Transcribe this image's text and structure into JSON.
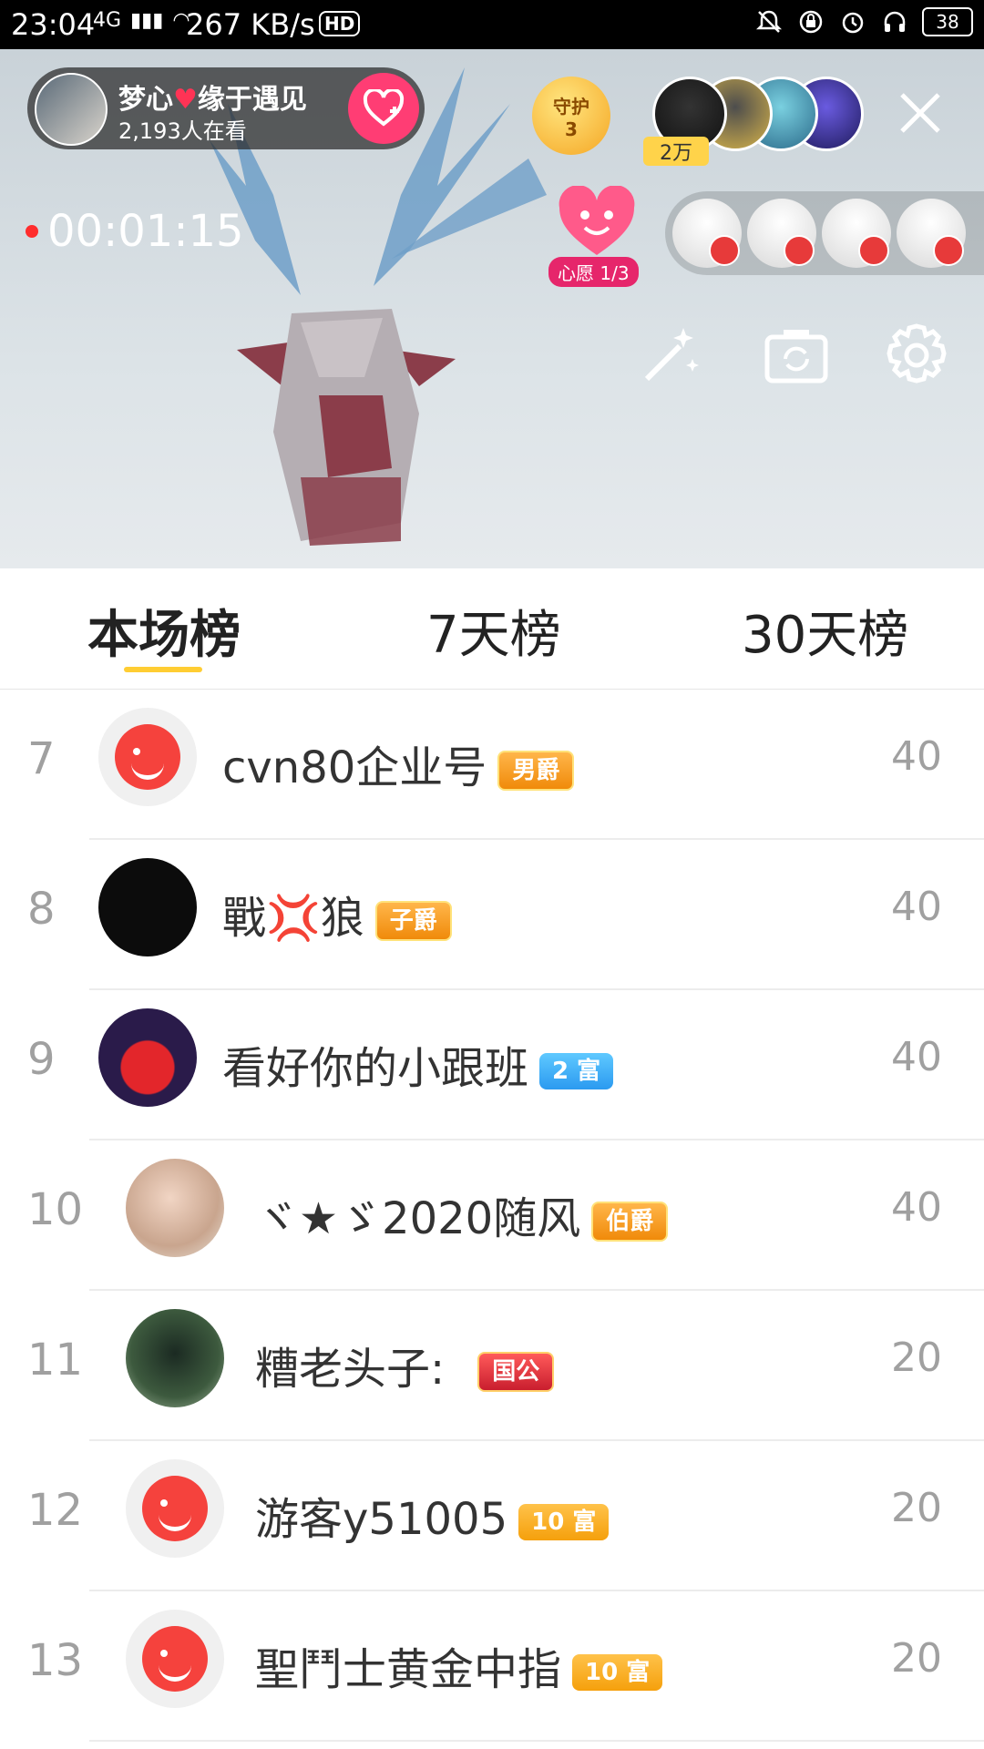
{
  "status_bar": {
    "time": "23:04",
    "network": "4G",
    "speed": "267 KB/s",
    "hd": "HD",
    "battery": "38"
  },
  "live": {
    "host_name": "梦心❤️缘于遇见",
    "host_name_prefix": "梦心",
    "host_name_suffix": "缘于遇见",
    "viewers": "2,193人在看",
    "guard_label": "守护",
    "guard_count": "3",
    "fans_badge": "2万",
    "timer": "00:01:15",
    "wish_label": "心愿 1/3"
  },
  "tabs": [
    {
      "label": "本场榜",
      "active": true
    },
    {
      "label": "7天榜",
      "active": false
    },
    {
      "label": "30天榜",
      "active": false
    }
  ],
  "ranking": [
    {
      "rank": "7",
      "name": "cvn80企业号",
      "badge": "男爵",
      "score": "40"
    },
    {
      "rank": "8",
      "name": "戰💢狼",
      "badge": "子爵",
      "score": "40"
    },
    {
      "rank": "9",
      "name": "看好你的小跟班",
      "badge": "2 富",
      "score": "40"
    },
    {
      "rank": "10",
      "name": "ヾ★ゞ2020随风",
      "badge": "伯爵",
      "score": "40"
    },
    {
      "rank": "11",
      "name": "糟老头子:",
      "badge": "国公",
      "score": "20"
    },
    {
      "rank": "12",
      "name": "游客y51005",
      "badge": "10 富",
      "score": "20"
    },
    {
      "rank": "13",
      "name": "聖鬥士黄金中指",
      "badge": "10 富",
      "score": "20"
    }
  ],
  "colors": {
    "accent_tab": "#ffcd33",
    "follow": "#ff3d74",
    "live_dot": "#ff2d2d"
  }
}
